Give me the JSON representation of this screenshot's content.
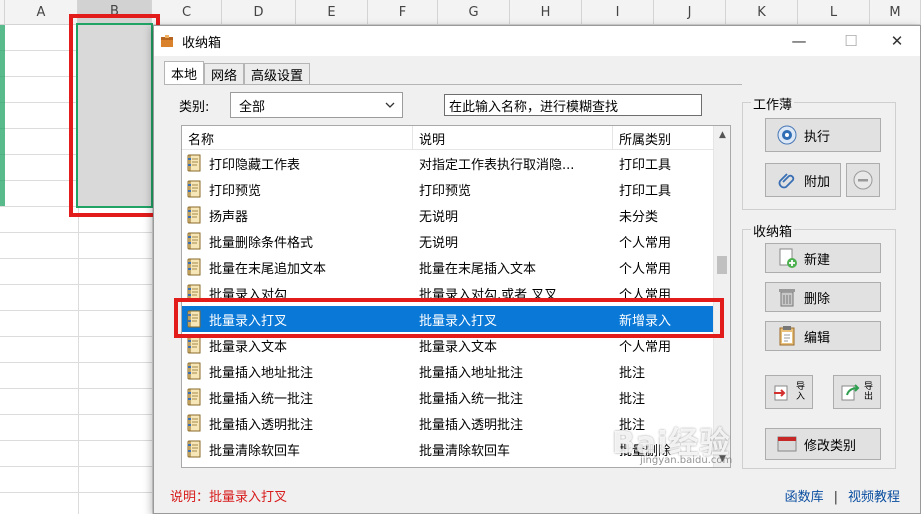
{
  "spreadsheet": {
    "columns": [
      "A",
      "B",
      "C",
      "D",
      "E",
      "F",
      "G",
      "H",
      "I",
      "J",
      "K",
      "L",
      "M"
    ]
  },
  "dialog": {
    "title": "收纳箱",
    "window_buttons": {
      "minimize": "—",
      "maximize": "☐",
      "close": "✕"
    },
    "tabs": [
      "本地",
      "网络",
      "高级设置"
    ],
    "category_label": "类别:",
    "category_value": "全部",
    "search_value": "在此输入名称，进行模糊查找",
    "list": {
      "headers": [
        "名称",
        "说明",
        "所属类别"
      ],
      "rows": [
        {
          "name": "打印隐藏工作表",
          "desc": "对指定工作表执行取消隐...",
          "cat": "打印工具",
          "selected": false
        },
        {
          "name": "打印预览",
          "desc": "打印预览",
          "cat": "打印工具",
          "selected": false
        },
        {
          "name": "扬声器",
          "desc": "无说明",
          "cat": "未分类",
          "selected": false
        },
        {
          "name": "批量删除条件格式",
          "desc": "无说明",
          "cat": "个人常用",
          "selected": false
        },
        {
          "name": "批量在末尾追加文本",
          "desc": "批量在末尾插入文本",
          "cat": "个人常用",
          "selected": false
        },
        {
          "name": "批量录入对勾",
          "desc": "批量录入对勾,或者 叉叉",
          "cat": "个人常用",
          "selected": false
        },
        {
          "name": "批量录入打叉",
          "desc": "批量录入打叉",
          "cat": "新增录入",
          "selected": true
        },
        {
          "name": "批量录入文本",
          "desc": "批量录入文本",
          "cat": "个人常用",
          "selected": false
        },
        {
          "name": "批量插入地址批注",
          "desc": "批量插入地址批注",
          "cat": "批注",
          "selected": false
        },
        {
          "name": "批量插入统一批注",
          "desc": "批量插入统一批注",
          "cat": "批注",
          "selected": false
        },
        {
          "name": "批量插入透明批注",
          "desc": "批量插入透明批注",
          "cat": "批注",
          "selected": false
        },
        {
          "name": "批量清除软回车",
          "desc": "批量清除软回车",
          "cat": "批量删除",
          "selected": false
        }
      ]
    },
    "workbook_group": {
      "title": "工作薄",
      "execute_label": "执行",
      "attach_label": "附加"
    },
    "box_group": {
      "title": "收纳箱",
      "new_label": "新建",
      "delete_label": "删除",
      "edit_label": "编辑",
      "import_label": "导入",
      "export_label": "导出",
      "modify_category_label": "修改类别"
    },
    "footer": {
      "status": "说明：批量录入打叉",
      "link_functions": "函数库",
      "separator": "|",
      "link_video": "视频教程"
    }
  },
  "watermark": {
    "main": "Bai经验",
    "sub": "jingyan.baidu.com"
  },
  "colors": {
    "selection_blue": "#0a78d7",
    "annotation_red": "#e21b1b",
    "excel_green": "#21a366",
    "status_red": "#d81b1b"
  }
}
